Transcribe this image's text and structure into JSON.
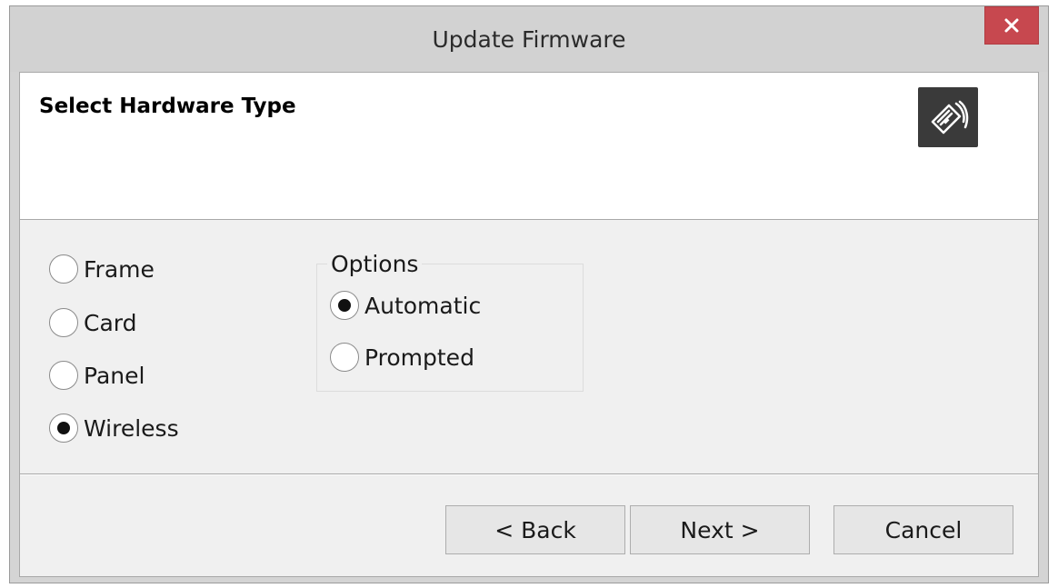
{
  "window": {
    "title": "Update Firmware",
    "close_icon": "close-icon"
  },
  "header": {
    "title": "Select Hardware Type",
    "icon": "hardware-swipe-device-icon"
  },
  "hardware_types": [
    {
      "label": "Frame",
      "selected": false
    },
    {
      "label": "Card",
      "selected": false
    },
    {
      "label": "Panel",
      "selected": false
    },
    {
      "label": "Wireless",
      "selected": true
    }
  ],
  "options": {
    "label": "Options",
    "items": [
      {
        "label": "Automatic",
        "selected": true
      },
      {
        "label": "Prompted",
        "selected": false
      }
    ]
  },
  "buttons": {
    "back": "< Back",
    "next": "Next >",
    "cancel": "Cancel"
  },
  "colors": {
    "close_button": "#c7484f",
    "dialog_background": "#f0f0f0",
    "titlebar": "#d2d2d2"
  }
}
